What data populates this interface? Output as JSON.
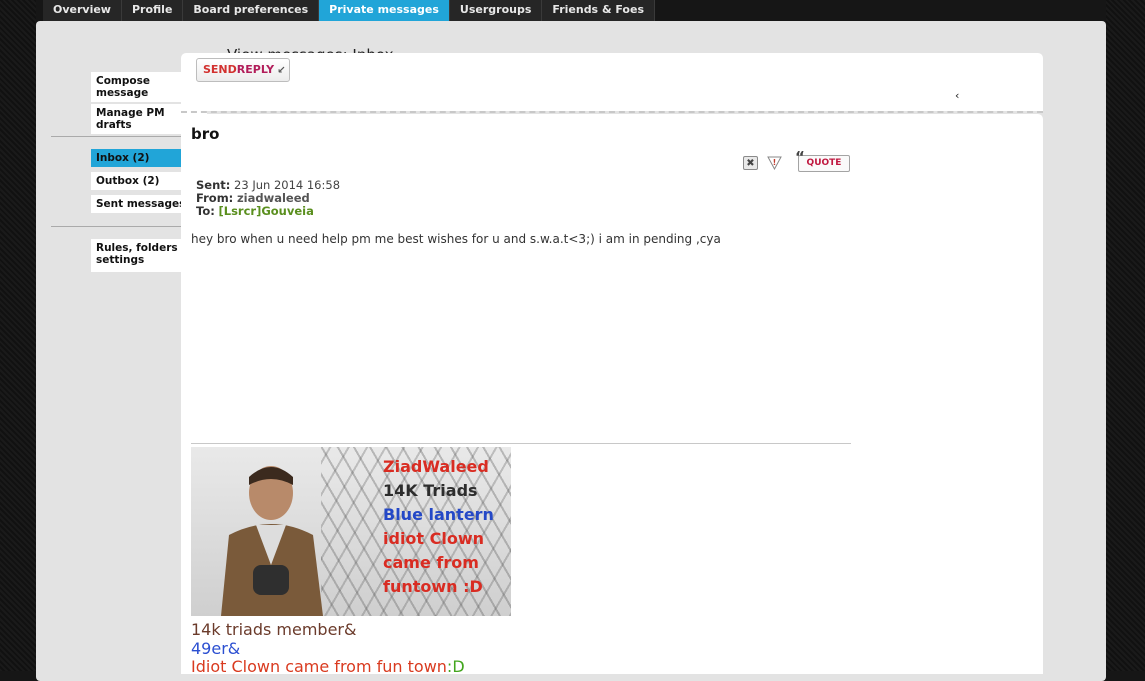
{
  "tabs": [
    "Overview",
    "Profile",
    "Board preferences",
    "Private messages",
    "Usergroups",
    "Friends & Foes"
  ],
  "active_tab": "Private messages",
  "page_title": "View messages: Inbox",
  "sidebar": {
    "compose": "Compose message",
    "drafts": "Manage PM drafts",
    "inbox": "Inbox (2)",
    "outbox": "Outbox (2)",
    "sent": "Sent messages",
    "rules": "Rules, folders & settings"
  },
  "reply_button": {
    "part1": "SEND",
    "part2": "REPLY"
  },
  "message": {
    "subject": "bro",
    "sent_label": "Sent:",
    "sent_value": "23 Jun 2014 16:58",
    "from_label": "From:",
    "from_value": "ziadwaleed",
    "to_label": "To:",
    "to_value": "[Lsrcr]Gouveia",
    "body": "hey bro when u need help pm me best wishes for u and s.w.a.t<3;) i am in pending ,cya",
    "quote_label": "QUOTE"
  },
  "signature": {
    "image_lines": [
      "ZiadWaleed",
      "14K Triads",
      "Blue lantern",
      "idiot Clown",
      "came from",
      "funtown :D"
    ],
    "line1": "14k triads member&",
    "line2": "49er&",
    "line3": "Idiot Clown came from fun town",
    "line3_suffix": ":D"
  },
  "colors": {
    "accent": "#21a5d8",
    "to_user": "#5a8f1e"
  }
}
